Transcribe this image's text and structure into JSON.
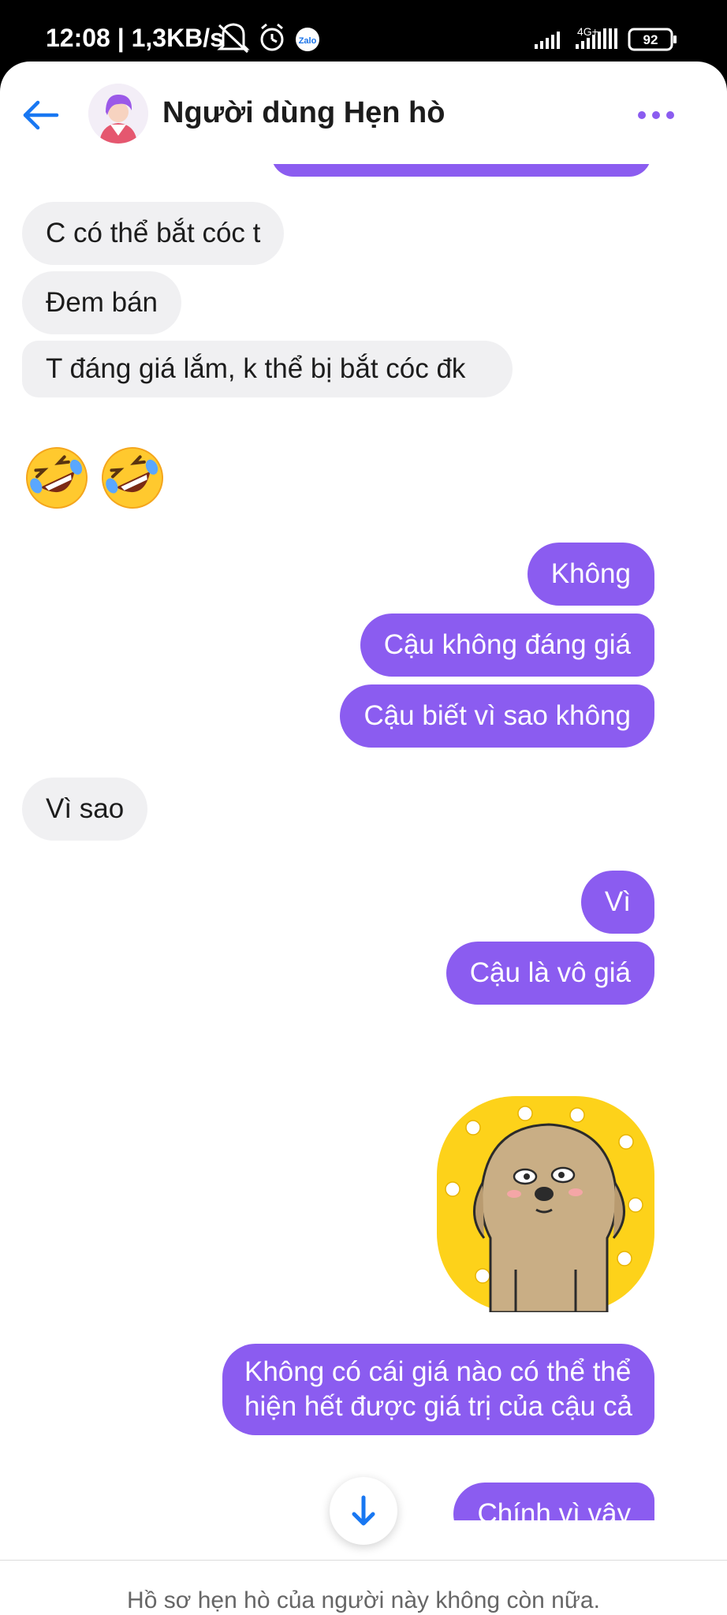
{
  "status_bar": {
    "time": "12:08",
    "speed": "1,3KB/s",
    "zalo": "Zalo",
    "network": "4G+",
    "battery": "92"
  },
  "header": {
    "title": "Người dùng Hẹn hò"
  },
  "messages": [
    {
      "side": "in",
      "text": "C có thể bắt cóc t"
    },
    {
      "side": "in",
      "text": "Đem bán"
    },
    {
      "side": "in",
      "text": "T đáng giá lắm, k thể bị bắt cóc đk"
    },
    {
      "side": "out",
      "text": "Không"
    },
    {
      "side": "out",
      "text": "Cậu không đáng giá"
    },
    {
      "side": "out",
      "text": "Cậu biết vì sao không"
    },
    {
      "side": "in",
      "text": "Vì sao"
    },
    {
      "side": "out",
      "text": "Vì"
    },
    {
      "side": "out",
      "text": "Cậu là vô giá"
    },
    {
      "side": "out",
      "text": "Không có cái giá nào có thể thể hiện hết được giá trị của cậu cả"
    },
    {
      "side": "out",
      "text": "Chính vì vậy"
    }
  ],
  "emoji": [
    "rolling-on-floor-laughing",
    "rolling-on-floor-laughing"
  ],
  "sticker": "dog-sticker",
  "footer": {
    "notice": "Hồ sơ hẹn hò của người này không còn nữa."
  },
  "colors": {
    "accent": "#8b5cf0",
    "incoming": "#f0f0f2",
    "back_arrow": "#1877f2"
  }
}
